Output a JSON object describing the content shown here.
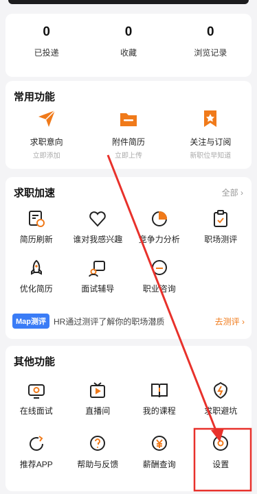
{
  "stats": [
    {
      "value": "0",
      "label": "已投递"
    },
    {
      "value": "0",
      "label": "收藏"
    },
    {
      "value": "0",
      "label": "浏览记录"
    }
  ],
  "common": {
    "title": "常用功能",
    "items": [
      {
        "label": "求职意向",
        "sub": "立即添加",
        "icon": "paper-plane-icon"
      },
      {
        "label": "附件简历",
        "sub": "立即上传",
        "icon": "folder-icon"
      },
      {
        "label": "关注与订阅",
        "sub": "新职位早知道",
        "icon": "bookmark-star-icon"
      }
    ]
  },
  "speed": {
    "title": "求职加速",
    "more": "全部 ›",
    "row1": [
      {
        "label": "简历刷新",
        "icon": "resume-refresh-icon"
      },
      {
        "label": "谁对我感兴趣",
        "icon": "heart-icon"
      },
      {
        "label": "竞争力分析",
        "icon": "pie-chart-icon"
      },
      {
        "label": "职场测评",
        "icon": "clipboard-icon"
      }
    ],
    "row2": [
      {
        "label": "优化简历",
        "icon": "rocket-icon"
      },
      {
        "label": "面试辅导",
        "icon": "tutor-icon"
      },
      {
        "label": "职业咨询",
        "icon": "consult-icon"
      }
    ],
    "banner": {
      "badge": "Map测评",
      "text": "HR通过测评了解你的职场潜质",
      "action": "去测评 ›"
    }
  },
  "other": {
    "title": "其他功能",
    "row1": [
      {
        "label": "在线面试",
        "icon": "camera-icon"
      },
      {
        "label": "直播间",
        "icon": "tv-icon"
      },
      {
        "label": "我的课程",
        "icon": "book-icon"
      },
      {
        "label": "求职避坑",
        "icon": "shield-bolt-icon"
      }
    ],
    "row2": [
      {
        "label": "推荐APP",
        "icon": "share-icon"
      },
      {
        "label": "帮助与反馈",
        "icon": "help-icon"
      },
      {
        "label": "薪酬查询",
        "icon": "yen-icon"
      },
      {
        "label": "设置",
        "icon": "settings-icon"
      }
    ]
  },
  "colors": {
    "accent": "#f07a1a",
    "annotation": "#e8312b",
    "badge": "#3a7cf6"
  }
}
